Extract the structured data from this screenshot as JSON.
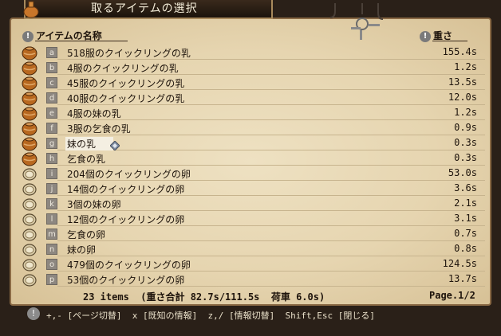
{
  "window": {
    "title": "取るアイテムの選択"
  },
  "columns": {
    "name_header": "アイテムの名称",
    "weight_header": "重さ"
  },
  "items": [
    {
      "key": "a",
      "name": "518服のクイックリングの乳",
      "weight": "155.4s",
      "icon": "jar-icon"
    },
    {
      "key": "b",
      "name": "4服のクイックリングの乳",
      "weight": "1.2s",
      "icon": "jar-icon"
    },
    {
      "key": "c",
      "name": "45服のクイックリングの乳",
      "weight": "13.5s",
      "icon": "jar-icon"
    },
    {
      "key": "d",
      "name": "40服のクイックリングの乳",
      "weight": "12.0s",
      "icon": "jar-icon"
    },
    {
      "key": "e",
      "name": "4服の妹の乳",
      "weight": "1.2s",
      "icon": "jar-icon"
    },
    {
      "key": "f",
      "name": "3服の乞食の乳",
      "weight": "0.9s",
      "icon": "jar-icon"
    },
    {
      "key": "g",
      "name": "妹の乳",
      "weight": "0.3s",
      "icon": "jar-icon",
      "selected": true
    },
    {
      "key": "h",
      "name": "乞食の乳",
      "weight": "0.3s",
      "icon": "jar-icon"
    },
    {
      "key": "i",
      "name": "204個のクイックリングの卵",
      "weight": "53.0s",
      "icon": "egg-icon"
    },
    {
      "key": "j",
      "name": "14個のクイックリングの卵",
      "weight": "3.6s",
      "icon": "egg-icon"
    },
    {
      "key": "k",
      "name": "3個の妹の卵",
      "weight": "2.1s",
      "icon": "egg-icon"
    },
    {
      "key": "l",
      "name": "12個のクイックリングの卵",
      "weight": "3.1s",
      "icon": "egg-icon"
    },
    {
      "key": "m",
      "name": "乞食の卵",
      "weight": "0.7s",
      "icon": "egg-icon"
    },
    {
      "key": "n",
      "name": "妹の卵",
      "weight": "0.8s",
      "icon": "egg-icon"
    },
    {
      "key": "o",
      "name": "479個のクイックリングの卵",
      "weight": "124.5s",
      "icon": "egg-icon"
    },
    {
      "key": "p",
      "name": "53個のクイックリングの卵",
      "weight": "13.7s",
      "icon": "egg-icon"
    }
  ],
  "footer": {
    "summary": "23 items  (重さ合計 82.7s/111.5s  荷車 6.0s)",
    "page": "Page.1/2",
    "help": "+,- [ページ切替]  x [既知の情報]  z,/ [情報切替]  Shift,Esc [閉じる]"
  },
  "colors": {
    "paper": "#e6d5b0",
    "text": "#1e140c",
    "key_bg": "#8d8780"
  }
}
